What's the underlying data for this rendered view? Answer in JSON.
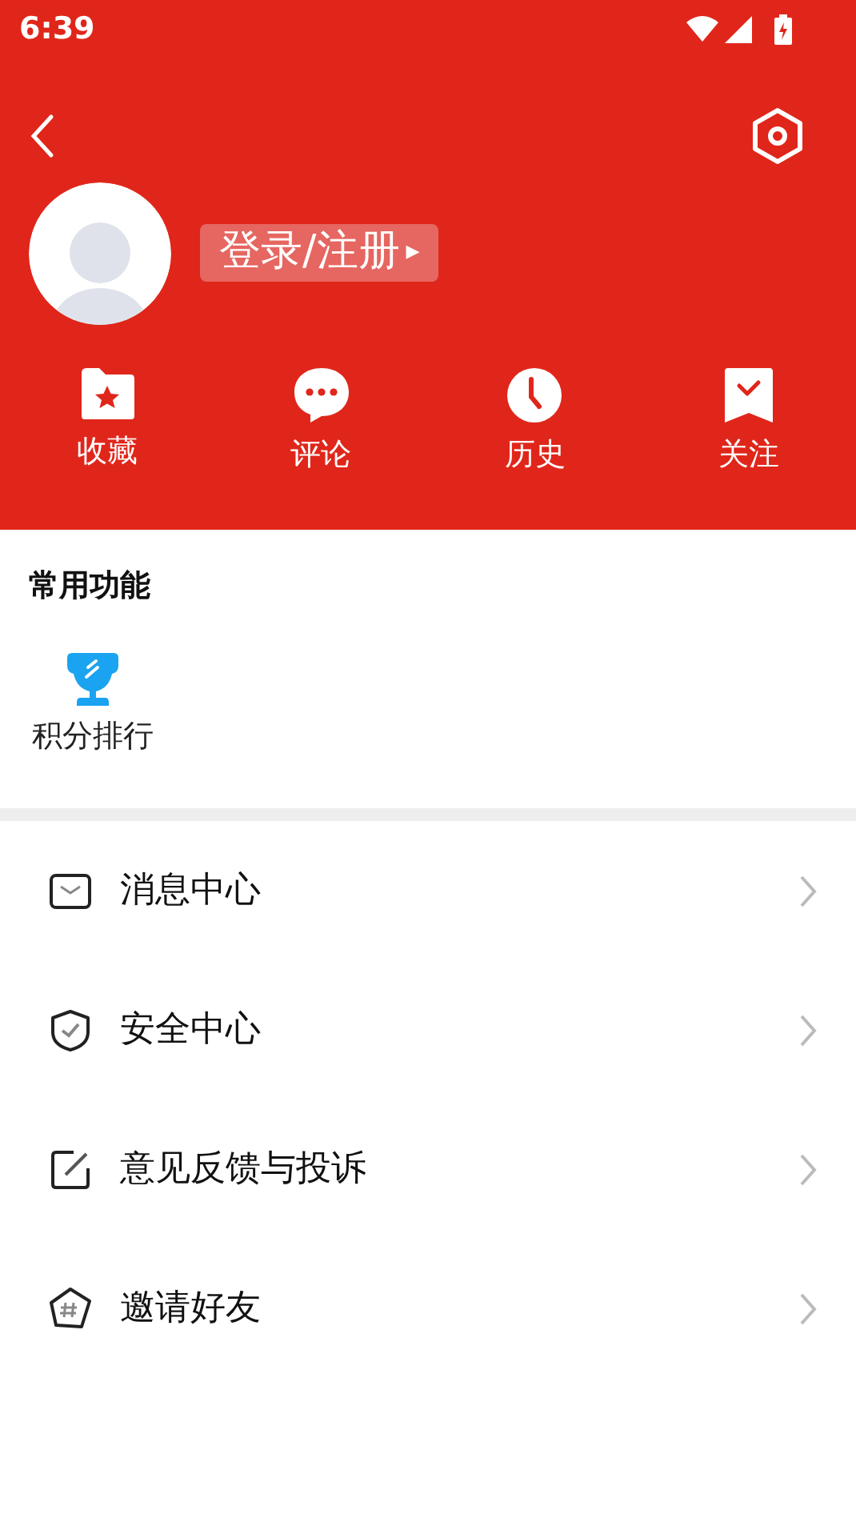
{
  "status_bar": {
    "time": "6:39"
  },
  "profile": {
    "login_label": "登录/注册",
    "arrow": "▸"
  },
  "shortcuts": [
    {
      "label": "收藏"
    },
    {
      "label": "评论"
    },
    {
      "label": "历史"
    },
    {
      "label": "关注"
    }
  ],
  "common_functions": {
    "title": "常用功能",
    "items": [
      {
        "label": "积分排行"
      }
    ]
  },
  "menu": [
    {
      "label": "消息中心"
    },
    {
      "label": "安全中心"
    },
    {
      "label": "意见反馈与投诉"
    },
    {
      "label": "邀请好友"
    }
  ]
}
